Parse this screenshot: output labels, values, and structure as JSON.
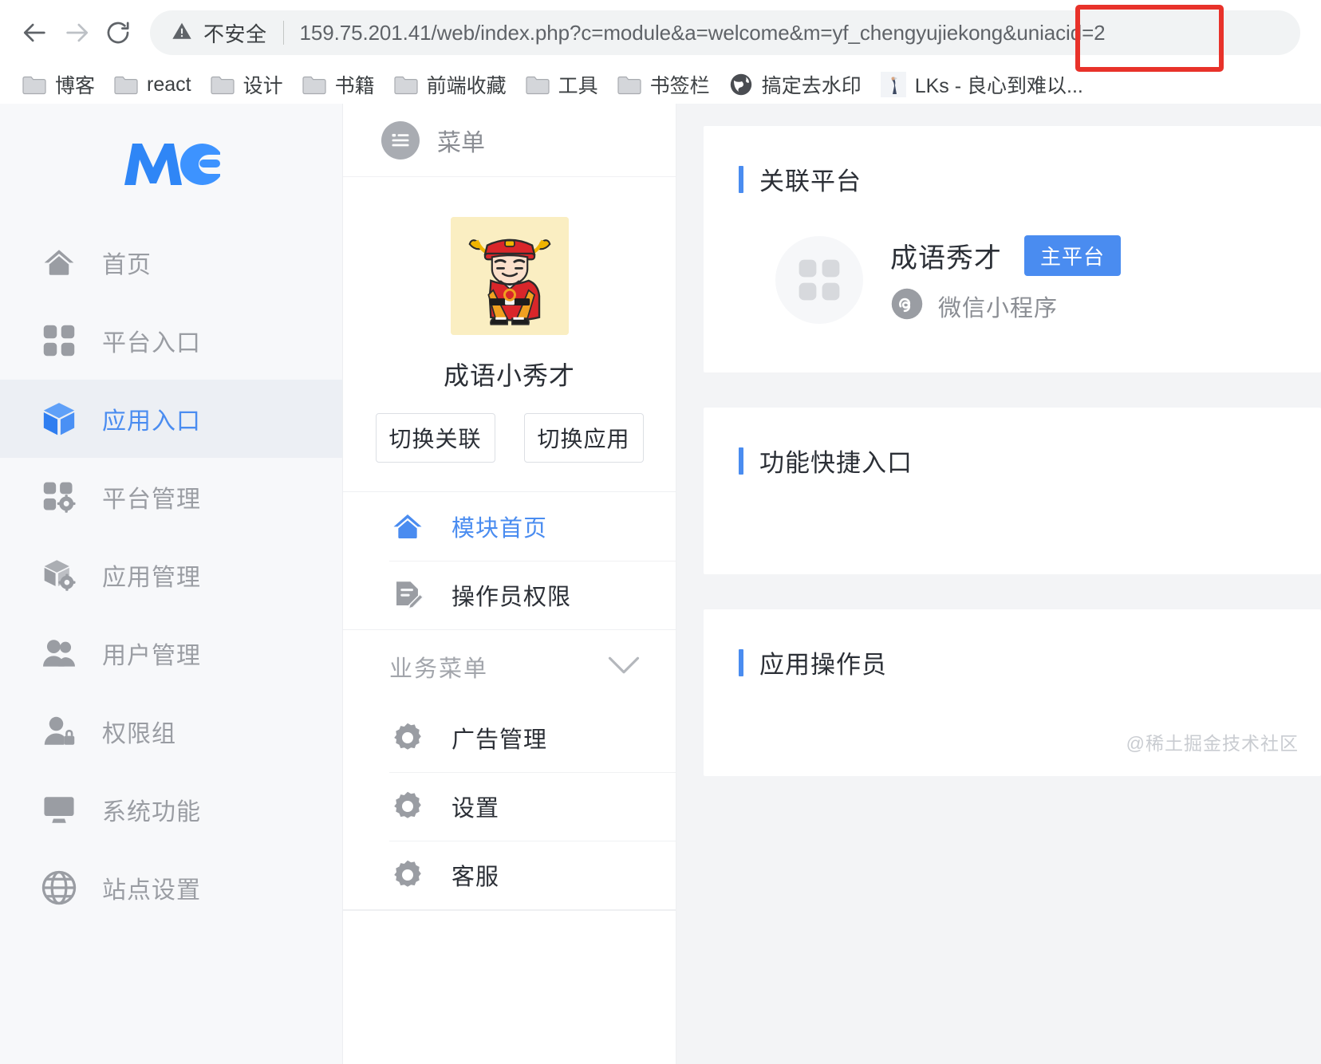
{
  "browser": {
    "back_icon": "back-arrow-icon",
    "forward_icon": "forward-arrow-icon",
    "reload_icon": "reload-icon",
    "security_icon": "warning-triangle-icon",
    "security_label": "不安全",
    "url": "159.75.201.41/web/index.php?c=module&a=welcome&m=yf_chengyujiekong&uniacid=2",
    "annotation_color": "#e8322a",
    "bookmarks": [
      {
        "label": "博客",
        "icon": "folder-icon"
      },
      {
        "label": "react",
        "icon": "folder-icon"
      },
      {
        "label": "设计",
        "icon": "folder-icon"
      },
      {
        "label": "书籍",
        "icon": "folder-icon"
      },
      {
        "label": "前端收藏",
        "icon": "folder-icon"
      },
      {
        "label": "工具",
        "icon": "folder-icon"
      },
      {
        "label": "书签栏",
        "icon": "folder-icon"
      },
      {
        "label": "搞定去水印",
        "icon": "globe-icon"
      },
      {
        "label": "LKs - 良心到难以...",
        "icon": "site-favicon"
      }
    ]
  },
  "sidebar": {
    "logo_text": "MC",
    "logo_color": "#2f86f6",
    "items": [
      {
        "label": "首页",
        "icon": "home-icon",
        "active": false
      },
      {
        "label": "平台入口",
        "icon": "grid-icon",
        "active": false
      },
      {
        "label": "应用入口",
        "icon": "cube-icon",
        "active": true
      },
      {
        "label": "平台管理",
        "icon": "grid-gear-icon",
        "active": false
      },
      {
        "label": "应用管理",
        "icon": "cube-gear-icon",
        "active": false
      },
      {
        "label": "用户管理",
        "icon": "users-icon",
        "active": false
      },
      {
        "label": "权限组",
        "icon": "user-lock-icon",
        "active": false
      },
      {
        "label": "系统功能",
        "icon": "monitor-icon",
        "active": false
      },
      {
        "label": "站点设置",
        "icon": "globe-icon",
        "active": false
      }
    ]
  },
  "menu_panel": {
    "header_label": "菜单",
    "header_icon": "list-circle-icon",
    "app": {
      "name": "成语小秀才",
      "avatar_icon": "scholar-avatar",
      "avatar_bg": "#faeec2",
      "buttons": [
        {
          "label": "切换关联"
        },
        {
          "label": "切换应用"
        }
      ]
    },
    "primary_items": [
      {
        "label": "模块首页",
        "icon": "home-icon",
        "active": true
      },
      {
        "label": "操作员权限",
        "icon": "document-pen-icon",
        "active": false
      }
    ],
    "group": {
      "title": "业务菜单",
      "collapse_icon": "chevron-down-icon",
      "items": [
        {
          "label": "广告管理",
          "icon": "gear-icon"
        },
        {
          "label": "设置",
          "icon": "gear-icon"
        },
        {
          "label": "客服",
          "icon": "gear-icon"
        }
      ]
    }
  },
  "content": {
    "accent_color": "#4a8cf0",
    "panels": [
      {
        "title": "关联平台",
        "platform": {
          "name": "成语秀才",
          "badge": "主平台",
          "type": "微信小程序",
          "logo_icon": "grid-icon",
          "type_icon": "wechat-miniprogram-icon"
        }
      },
      {
        "title": "功能快捷入口"
      },
      {
        "title": "应用操作员"
      }
    ],
    "watermark": "@稀土掘金技术社区"
  }
}
